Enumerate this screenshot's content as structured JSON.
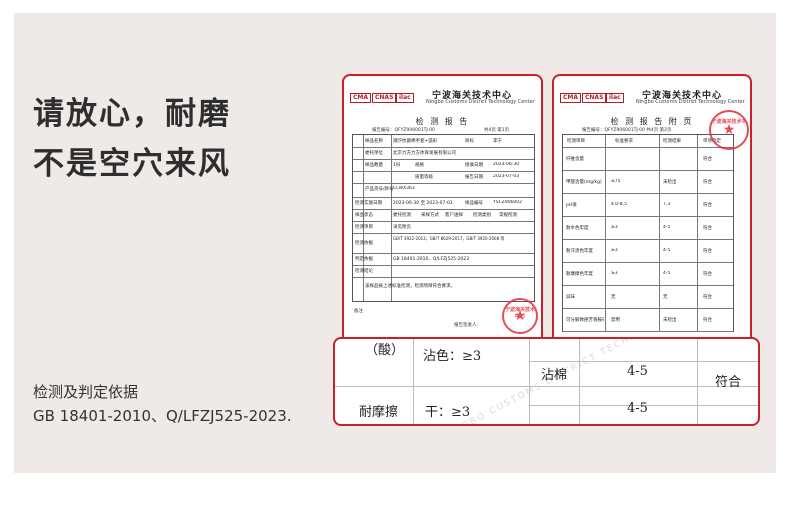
{
  "headline": {
    "line1": "请放心，耐磨",
    "line2": "不是空穴来风"
  },
  "basis": {
    "line1": "检测及判定依据",
    "line2": "GB 18401-2010、Q/LFZJ525-2023."
  },
  "report_left": {
    "cn_title": "宁波海关技术中心",
    "en_title": "Ningbo Customs District Technology Center",
    "logos": [
      "CMA",
      "CNAS",
      "ilac"
    ],
    "doc_name": "检 测 报 告",
    "report_no": "报告编号：QFYZ906001TJ-00",
    "page_no": "共4页 第1页",
    "sample_name_label": "样品名称",
    "sample_name_value": "潮汐抗菌棉手套+弧形",
    "brand_label": "商标",
    "brand_value": "李宁",
    "client_label": "委托单位",
    "client_value": "北京力方力方体育发展有限公司",
    "quantity_label": "样品数量",
    "quantity_value": "1份",
    "spec_label": "规格",
    "date_label": "接收日期",
    "date_value": "2023-06-30",
    "grade_label": "质量等级",
    "end_label": "报告日期",
    "end_value": "2023-07-03",
    "product_no_label": "产品货号/款号",
    "product_no_value": "LCWX363",
    "test_date_label": "检测实施日期",
    "test_date_value": "2023-06-30 至 2023-07-03",
    "sample_no_label": "样品编号",
    "sample_no_value": "YSCZ906002",
    "state_label": "样品状态",
    "state_value": "委托检测",
    "method_label": "采样方式",
    "method_value": "客户送样",
    "level_label": "检测类别",
    "level_value": "常规检测",
    "item_label": "检测项目",
    "item_value": "详见附页",
    "basis_label": "检测依据",
    "basis_value": "GB/T 3922-2013，GB/T 8629-2017，GB/T 3920-2008 等",
    "judge_label": "判定依据",
    "judge_value": "GB 18401-2010、Q/LFZJ525-2023",
    "conclusion_label": "检测结论",
    "conclusion_value": "该样品按上述标准检测，检测项目符合要求。",
    "remark_label": "备注",
    "footer_label": "报告签发人：",
    "stamp_text": "宁波海关技术中心"
  },
  "report_right": {
    "cn_title": "宁波海关技术中心",
    "en_title": "Ningbo Customs District Technology Center",
    "logos": [
      "CMA",
      "CNAS",
      "ilac"
    ],
    "doc_name": "检 测 报 告 附 页",
    "report_no": "报告编号：QFYZ906001TJ-00  共4页 第2页",
    "header_cols": [
      "检测项目",
      "标准要求",
      "检测结果",
      "单项判定"
    ],
    "rows": [
      {
        "item": "纤维含量",
        "req": "",
        "result": "",
        "judge": "符合"
      },
      {
        "item": "甲醛含量(mg/kg)",
        "req": "≤75",
        "result": "未检出",
        "judge": "符合"
      },
      {
        "item": "pH值",
        "req": "4.0-8.5",
        "result": "7.3",
        "judge": "符合"
      },
      {
        "item": "耐水色牢度",
        "req": "≥3",
        "result": "4-5",
        "judge": "符合"
      },
      {
        "item": "耐汗渍色牢度",
        "req": "≥3",
        "result": "4-5",
        "judge": "符合"
      },
      {
        "item": "耐摩擦色牢度",
        "req": "≥3",
        "result": "4-5",
        "judge": "符合"
      },
      {
        "item": "异味",
        "req": "无",
        "result": "无",
        "judge": "符合"
      },
      {
        "item": "可分解致癌芳香胺染料",
        "req": "禁用",
        "result": "未检出",
        "judge": "符合"
      }
    ],
    "stamp_text": "宁波海关技术中心"
  },
  "detail": {
    "sweat_label": "（酸）",
    "stain_label": "沾色：≥3",
    "cotton_label": "沾棉",
    "cotton_result": "4-5",
    "rub_label": "耐摩擦",
    "dry_label": "干：≥3",
    "dry_result": "4-5",
    "judge": "符合",
    "watermark": "NINGBO CUSTOMS DISTRICT TECHNOLOGY CENTER"
  }
}
